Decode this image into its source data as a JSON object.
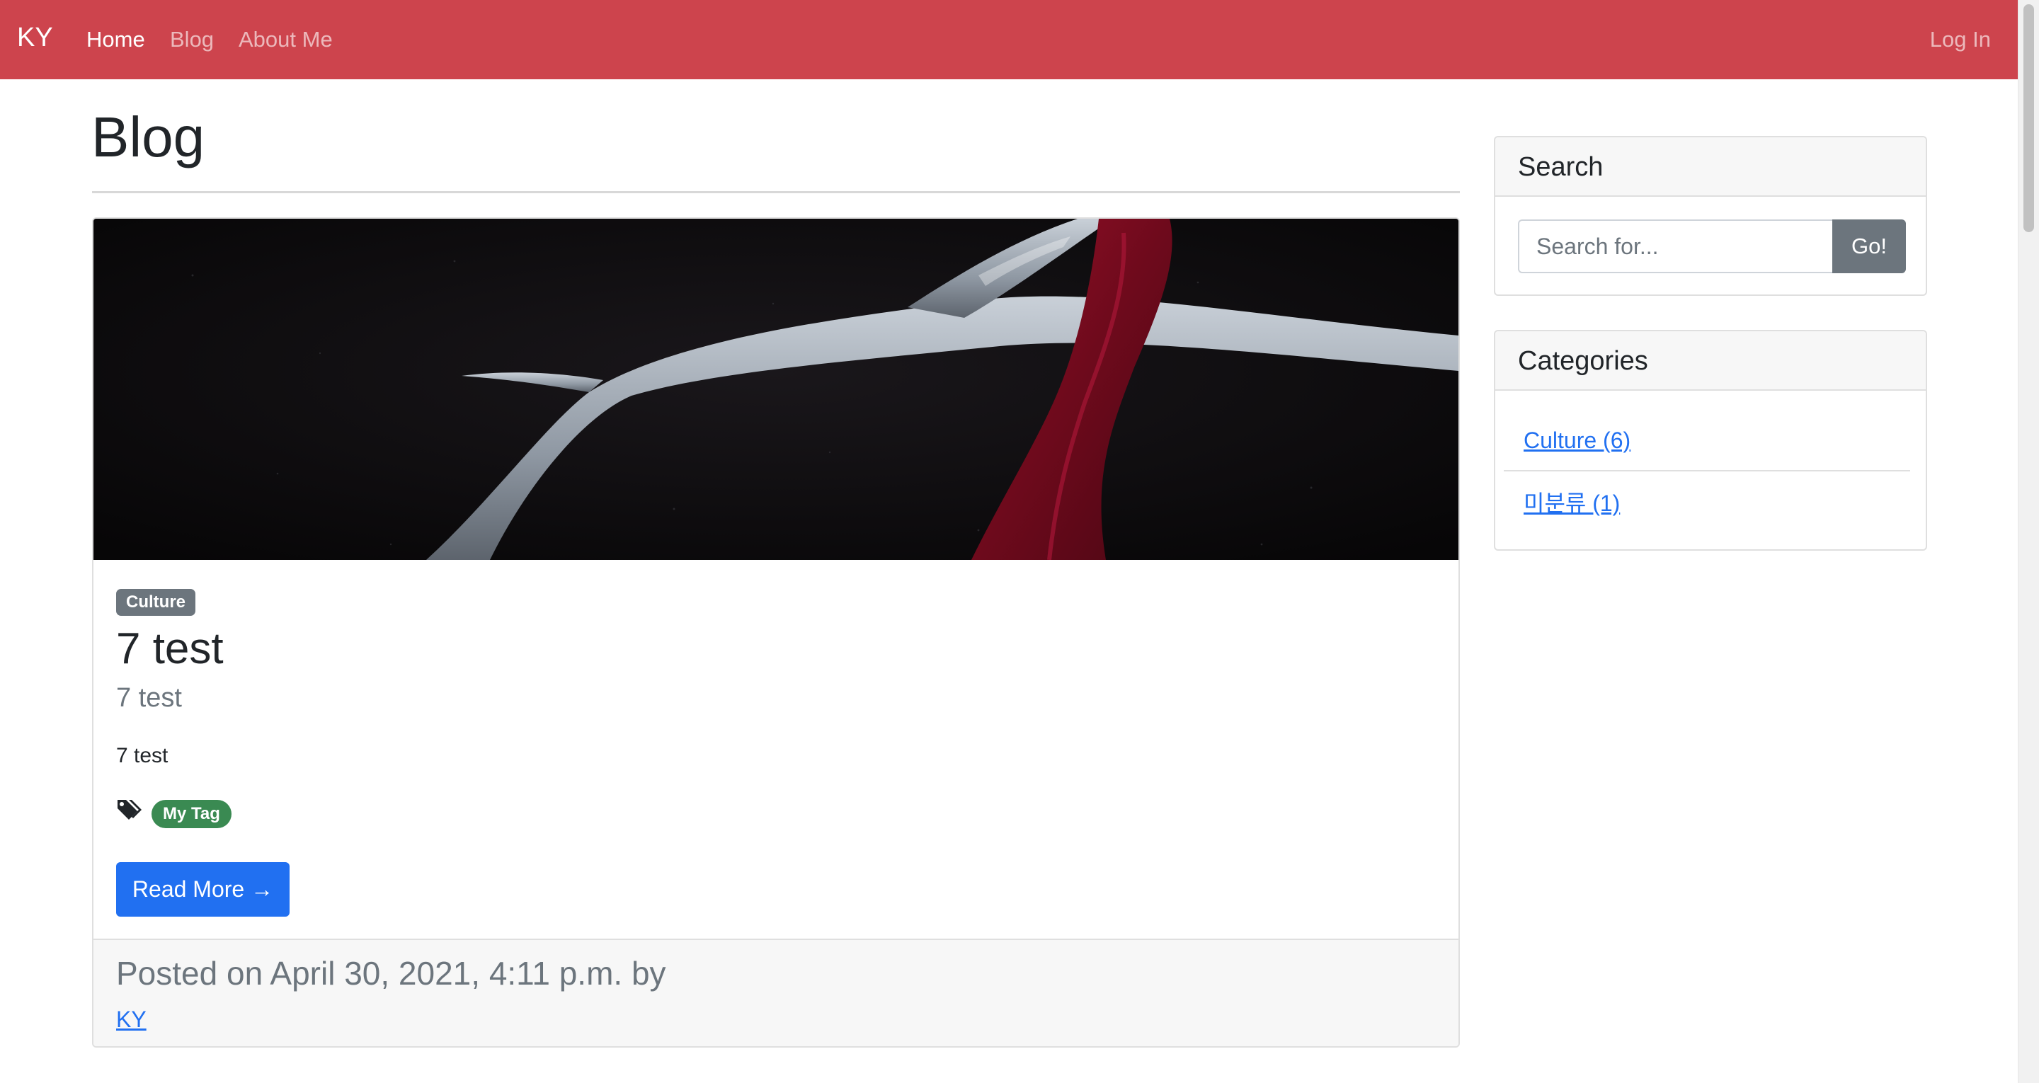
{
  "navbar": {
    "brand": "KY",
    "links": [
      {
        "label": "Home",
        "active": true
      },
      {
        "label": "Blog",
        "active": false
      },
      {
        "label": "About Me",
        "active": false
      }
    ],
    "login": "Log In",
    "color": "#cd444d"
  },
  "page": {
    "title": "Blog"
  },
  "post": {
    "category": "Culture",
    "title": "7 test",
    "subtitle": "7 test",
    "excerpt": "7 test",
    "tag": "My Tag",
    "read_more": "Read More →",
    "posted": "Posted on April 30, 2021, 4:11 p.m. by",
    "author": "KY",
    "image_icon": "antler-red-ribbon-image"
  },
  "sidebar": {
    "search": {
      "title": "Search",
      "placeholder": "Search for...",
      "button": "Go!"
    },
    "categories": {
      "title": "Categories",
      "items": [
        {
          "label": "Culture (6)"
        },
        {
          "label": "미분류 (1)"
        }
      ]
    }
  },
  "colors": {
    "primary": "#2170f1",
    "secondary": "#6c757d",
    "success": "#3a8a52"
  }
}
